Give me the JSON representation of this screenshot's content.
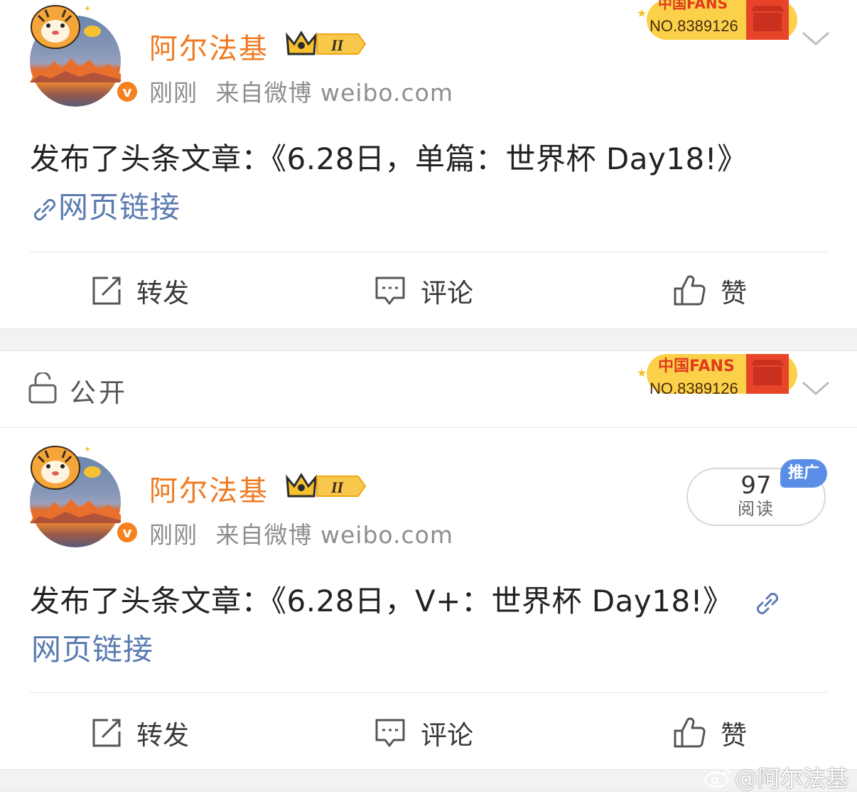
{
  "posts": [
    {
      "username": "阿尔法基",
      "time": "刚刚",
      "source": "来自微博 weibo.com",
      "content": "发布了头条文章：《6.28日，单篇：世界杯 Day18!》",
      "link_label": "网页链接",
      "actions": {
        "repost": "转发",
        "comment": "评论",
        "like": "赞"
      },
      "fans_badge_no": "NO.8389126",
      "level_badge": "II"
    },
    {
      "username": "阿尔法基",
      "time": "刚刚",
      "source": "来自微博 weibo.com",
      "content": "发布了头条文章：《6.28日，V+：世界杯 Day18!》",
      "link_label": "网页链接",
      "actions": {
        "repost": "转发",
        "comment": "评论",
        "like": "赞"
      },
      "reads": {
        "count": "97",
        "label": "阅读",
        "promo": "推广"
      },
      "level_badge": "II"
    }
  ],
  "privacy": {
    "label": "公开",
    "fans_badge_no": "NO.8389126"
  },
  "watermark": "@阿尔法基",
  "colors": {
    "username": "#f07a22",
    "link": "#5b7bb0",
    "promo": "#5a8ee6",
    "vbadge": "#f5821f"
  }
}
